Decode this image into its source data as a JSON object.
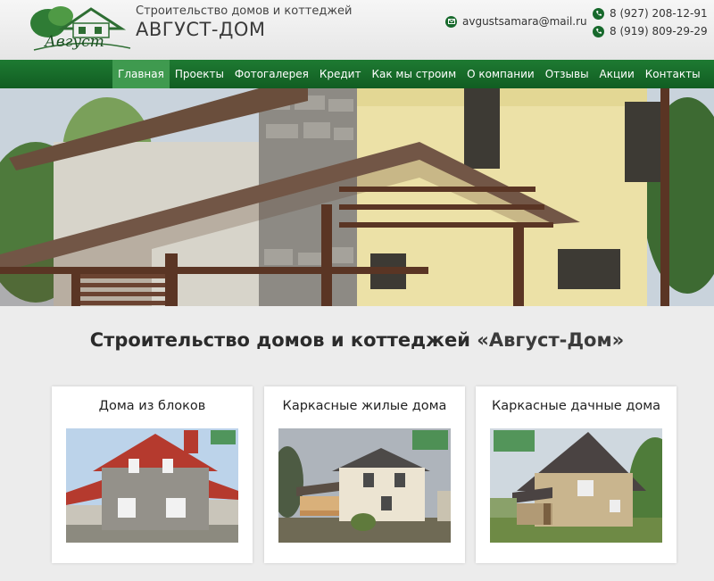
{
  "header": {
    "tagline": "Строительство домов и коттеджей",
    "brand": "АВГУСТ-ДОМ",
    "logo_text": "Август",
    "email": "avgustsamara@mail.ru",
    "phones": [
      "8 (927) 208-12-91",
      "8 (919) 809-29-29"
    ]
  },
  "icons": {
    "email": "mail-icon",
    "phone": "phone-icon"
  },
  "nav": {
    "items": [
      "Главная",
      "Проекты",
      "Фотогалерея",
      "Кредит",
      "Как мы строим",
      "О компании",
      "Отзывы",
      "Акции",
      "Контакты"
    ],
    "active": "Главная"
  },
  "main": {
    "title_prefix": "Строительство домов и коттеджей ",
    "title_accent": "«Август-Дом»"
  },
  "cards": [
    {
      "title": "Дома из блоков"
    },
    {
      "title": "Каркасные жилые дома"
    },
    {
      "title": "Каркасные дачные дома"
    }
  ],
  "colors": {
    "brand_green": "#17692c",
    "nav_active": "#3f9a4f",
    "background": "#ececec"
  }
}
